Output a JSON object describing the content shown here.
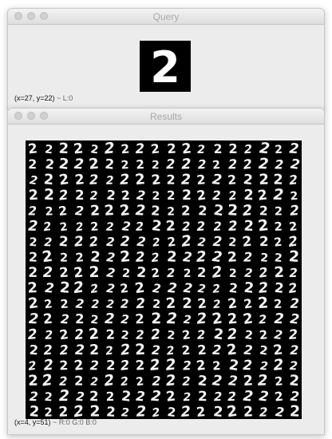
{
  "query_window": {
    "title": "Query",
    "query_digit": "2",
    "status": {
      "coords": "(x=27, y=22)",
      "sep": " ~ ",
      "value": "L:0"
    }
  },
  "results_window": {
    "title": "Results",
    "grid": {
      "rows": 18,
      "cols": 18,
      "digit": "2"
    },
    "status": {
      "coords": "(x=4, y=51)",
      "sep": " ~ ",
      "value": "R:0 G:0 B:0"
    }
  }
}
